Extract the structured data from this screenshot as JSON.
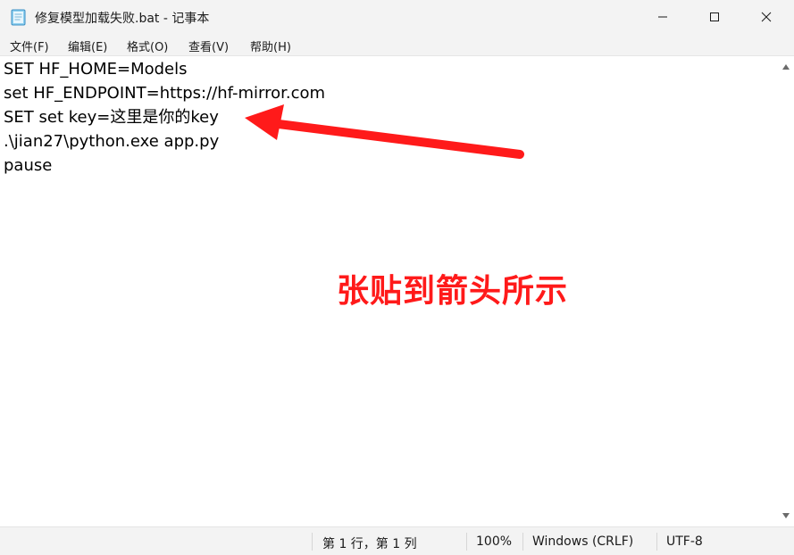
{
  "window": {
    "title": "修复模型加载失败.bat - 记事本"
  },
  "menu": [
    {
      "label": "文件(F)"
    },
    {
      "label": "编辑(E)"
    },
    {
      "label": "格式(O)"
    },
    {
      "label": "查看(V)"
    },
    {
      "label": "帮助(H)"
    }
  ],
  "editor": {
    "lines": [
      "SET HF_HOME=Models",
      "set HF_ENDPOINT=https://hf-mirror.com",
      "SET set key=这里是你的key",
      ".\\jian27\\python.exe app.py",
      "pause"
    ]
  },
  "annotation": {
    "text": "张贴到箭头所示",
    "color": "#ff1a1a"
  },
  "status": {
    "position": "第 1 行，第 1 列",
    "zoom": "100%",
    "line_ending": "Windows (CRLF)",
    "encoding": "UTF-8"
  },
  "icons": {
    "app": "notepad-icon",
    "minimize": "minimize-icon",
    "maximize": "maximize-icon",
    "close": "close-icon"
  }
}
